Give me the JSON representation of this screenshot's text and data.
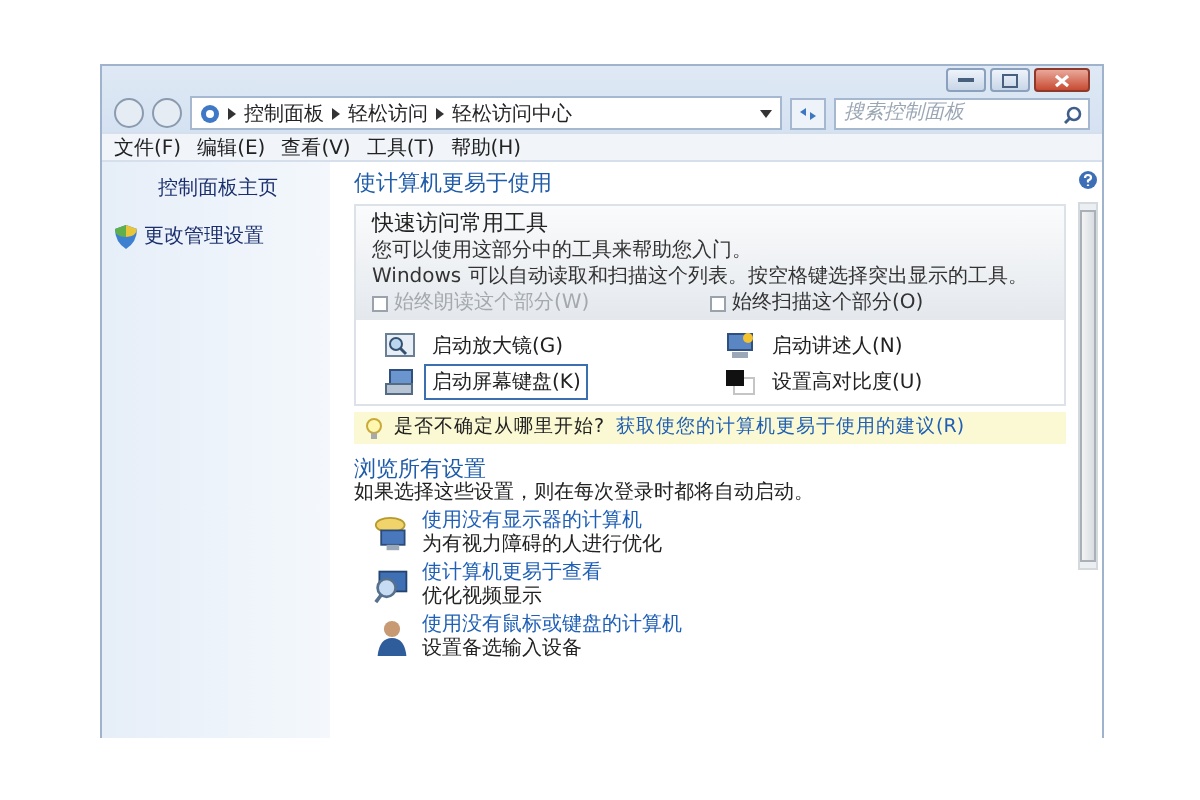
{
  "address_bar": {
    "breadcrumbs": [
      "控制面板",
      "轻松访问",
      "轻松访问中心"
    ]
  },
  "search": {
    "placeholder": "搜索控制面板"
  },
  "menu": [
    "文件(F)",
    "编辑(E)",
    "查看(V)",
    "工具(T)",
    "帮助(H)"
  ],
  "sidebar": {
    "items": [
      {
        "label": "控制面板主页",
        "kind": "link"
      },
      {
        "label": "更改管理设置",
        "kind": "shield"
      }
    ]
  },
  "main": {
    "title": "使计算机更易于使用",
    "quick_access": {
      "heading": "快速访问常用工具",
      "description": "您可以使用这部分中的工具来帮助您入门。",
      "scan_note": "Windows 可以自动读取和扫描这个列表。按空格键选择突出显示的工具。",
      "checkboxes": [
        {
          "label": "始终朗读这个部分(W)",
          "checked": false,
          "disabled": true
        },
        {
          "label": "始终扫描这个部分(O)",
          "checked": false,
          "disabled": false
        }
      ],
      "tools": [
        {
          "label": "启动放大镜(G)",
          "kind": "magnifier",
          "focused": false
        },
        {
          "label": "启动讲述人(N)",
          "kind": "narrator",
          "focused": false
        },
        {
          "label": "启动屏幕键盘(K)",
          "kind": "keyboard",
          "focused": true
        },
        {
          "label": "设置高对比度(U)",
          "kind": "contrast",
          "focused": false
        }
      ]
    },
    "tip": {
      "text": "是否不确定从哪里开始?",
      "link": "获取使您的计算机更易于使用的建议(R)"
    },
    "browse": {
      "title": "浏览所有设置",
      "description": "如果选择这些设置，则在每次登录时都将自动启动。",
      "items": [
        {
          "kind": "display",
          "link": "使用没有显示器的计算机",
          "description": "为有视力障碍的人进行优化"
        },
        {
          "kind": "magnify",
          "link": "使计算机更易于查看",
          "description": "优化视频显示"
        },
        {
          "kind": "person",
          "link": "使用没有鼠标或键盘的计算机",
          "description": "设置备选输入设备"
        }
      ]
    }
  }
}
